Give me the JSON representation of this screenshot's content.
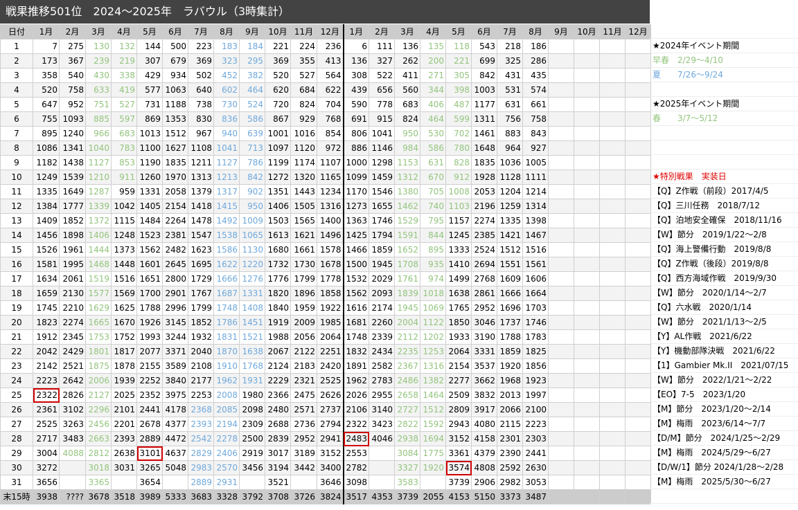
{
  "title": "戦果推移501位　2024～2025年　ラバウル（3時集計）",
  "header": [
    "日付",
    "1月",
    "2月",
    "3月",
    "4月",
    "5月",
    "6月",
    "7月",
    "8月",
    "9月",
    "10月",
    "11月",
    "12月",
    "1月",
    "2月",
    "3月",
    "4月",
    "5月",
    "6月",
    "7月",
    "8月",
    "9月",
    "10月",
    "11月",
    "12月"
  ],
  "footer_label": "末15時",
  "footer": [
    "3938",
    "????",
    "3678",
    "3518",
    "3989",
    "5333",
    "3683",
    "3328",
    "3792",
    "3708",
    "3726",
    "3824",
    "3517",
    "4353",
    "3739",
    "2055",
    "4153",
    "5150",
    "3373",
    "3487",
    "",
    "",
    "",
    "",
    ""
  ],
  "rows": [
    [
      7,
      275,
      130,
      132,
      144,
      500,
      223,
      183,
      184,
      221,
      224,
      236,
      6,
      111,
      136,
      135,
      118,
      543,
      218,
      186
    ],
    [
      173,
      367,
      239,
      219,
      307,
      679,
      369,
      323,
      295,
      369,
      355,
      413,
      136,
      327,
      262,
      200,
      221,
      699,
      325,
      286
    ],
    [
      358,
      540,
      430,
      338,
      429,
      934,
      502,
      452,
      382,
      520,
      527,
      564,
      308,
      522,
      411,
      271,
      305,
      842,
      431,
      435
    ],
    [
      520,
      758,
      633,
      419,
      577,
      1063,
      640,
      602,
      464,
      620,
      684,
      622,
      439,
      656,
      560,
      344,
      398,
      1003,
      531,
      574
    ],
    [
      647,
      952,
      751,
      527,
      731,
      1188,
      738,
      730,
      524,
      720,
      824,
      704,
      590,
      778,
      683,
      406,
      487,
      1177,
      631,
      661
    ],
    [
      755,
      1093,
      885,
      597,
      869,
      1353,
      830,
      836,
      586,
      867,
      929,
      768,
      691,
      915,
      824,
      464,
      599,
      1311,
      756,
      758
    ],
    [
      895,
      1240,
      966,
      683,
      1013,
      1512,
      967,
      940,
      639,
      1001,
      1016,
      854,
      806,
      1041,
      950,
      530,
      702,
      1461,
      883,
      843
    ],
    [
      1086,
      1341,
      1040,
      783,
      1100,
      1627,
      1108,
      1041,
      713,
      1097,
      1120,
      972,
      886,
      1146,
      984,
      586,
      780,
      1648,
      964,
      927
    ],
    [
      1182,
      1438,
      1127,
      853,
      1190,
      1835,
      1211,
      1127,
      786,
      1199,
      1174,
      1107,
      1000,
      1298,
      1153,
      631,
      828,
      1835,
      1036,
      1005
    ],
    [
      1249,
      1539,
      1210,
      911,
      1260,
      1970,
      1313,
      1213,
      842,
      1272,
      1320,
      1165,
      1099,
      1459,
      1312,
      670,
      912,
      1928,
      1128,
      1111
    ],
    [
      1335,
      1649,
      1287,
      959,
      1331,
      2058,
      1379,
      1317,
      902,
      1351,
      1443,
      1234,
      1170,
      1546,
      1380,
      705,
      1008,
      2053,
      1204,
      1214
    ],
    [
      1384,
      1777,
      1339,
      1042,
      1405,
      2154,
      1418,
      1415,
      950,
      1406,
      1505,
      1316,
      1273,
      1655,
      1462,
      740,
      1103,
      2196,
      1259,
      1314
    ],
    [
      1409,
      1852,
      1372,
      1115,
      1484,
      2264,
      1478,
      1492,
      1009,
      1503,
      1565,
      1400,
      1363,
      1746,
      1529,
      795,
      1157,
      2274,
      1335,
      1398
    ],
    [
      1456,
      1898,
      1406,
      1248,
      1523,
      2381,
      1547,
      1538,
      1065,
      1613,
      1621,
      1496,
      1425,
      1794,
      1591,
      844,
      1245,
      2385,
      1421,
      1467
    ],
    [
      1526,
      1961,
      1444,
      1373,
      1562,
      2482,
      1623,
      1586,
      1130,
      1680,
      1661,
      1578,
      1466,
      1859,
      1652,
      895,
      1333,
      2524,
      1512,
      1516
    ],
    [
      1581,
      1995,
      1468,
      1448,
      1601,
      2645,
      1695,
      1622,
      1220,
      1732,
      1730,
      1678,
      1500,
      1945,
      1708,
      935,
      1410,
      2694,
      1551,
      1561
    ],
    [
      1634,
      2061,
      1519,
      1516,
      1651,
      2800,
      1729,
      1666,
      1276,
      1776,
      1799,
      1778,
      1532,
      2029,
      1761,
      974,
      1499,
      2768,
      1609,
      1606
    ],
    [
      1659,
      2130,
      1577,
      1569,
      1700,
      2901,
      1767,
      1687,
      1331,
      1820,
      1896,
      1858,
      1562,
      2093,
      1839,
      1018,
      1638,
      2861,
      1666,
      1664
    ],
    [
      1745,
      2210,
      1629,
      1625,
      1788,
      2996,
      1799,
      1748,
      1408,
      1840,
      1959,
      1922,
      1616,
      2174,
      1945,
      1069,
      1765,
      2952,
      1696,
      1703
    ],
    [
      1823,
      2274,
      1665,
      1670,
      1926,
      3145,
      1852,
      1786,
      1451,
      1919,
      2009,
      1985,
      1681,
      2260,
      2004,
      1122,
      1850,
      3046,
      1737,
      1746
    ],
    [
      1912,
      2345,
      1753,
      1752,
      1993,
      3244,
      1932,
      1831,
      1521,
      1988,
      2056,
      2064,
      1748,
      2339,
      2112,
      1202,
      1933,
      3190,
      1788,
      1783
    ],
    [
      2042,
      2429,
      1801,
      1817,
      2077,
      3371,
      2040,
      1870,
      1638,
      2067,
      2122,
      2251,
      1832,
      2434,
      2235,
      1253,
      2064,
      3331,
      1859,
      1825
    ],
    [
      2142,
      2521,
      1875,
      1878,
      2155,
      3589,
      2108,
      1910,
      1768,
      2124,
      2183,
      2420,
      1891,
      2582,
      2367,
      1316,
      2154,
      3537,
      1920,
      1856
    ],
    [
      2223,
      2642,
      2006,
      1939,
      2252,
      3840,
      2177,
      1962,
      1931,
      2229,
      2321,
      2525,
      1962,
      2783,
      2486,
      1382,
      2277,
      3662,
      1968,
      1923
    ],
    [
      2322,
      2826,
      2127,
      2025,
      2352,
      3975,
      2253,
      2008,
      1980,
      2366,
      2475,
      2626,
      2026,
      2955,
      2658,
      1464,
      2509,
      3832,
      2013,
      1997
    ],
    [
      2361,
      3102,
      2296,
      2101,
      2441,
      4178,
      2368,
      2085,
      2098,
      2480,
      2571,
      2737,
      2106,
      3140,
      2727,
      1512,
      2809,
      3917,
      2066,
      2100
    ],
    [
      2525,
      3263,
      2456,
      2201,
      2678,
      4377,
      2393,
      2194,
      2309,
      2688,
      2736,
      2794,
      2322,
      3423,
      2822,
      1592,
      2943,
      4080,
      2115,
      2223
    ],
    [
      2717,
      3483,
      2663,
      2393,
      2889,
      4472,
      2542,
      2278,
      2500,
      2839,
      2952,
      2941,
      2483,
      4046,
      2938,
      1694,
      3152,
      4158,
      2301,
      2303
    ],
    [
      3004,
      4088,
      2812,
      2638,
      3101,
      4637,
      2829,
      2406,
      2919,
      3017,
      3189,
      3152,
      2553,
      "",
      3084,
      1775,
      3361,
      4379,
      2390,
      2441
    ],
    [
      3272,
      "",
      3018,
      3031,
      3265,
      5048,
      2983,
      2570,
      3456,
      3194,
      3442,
      3400,
      2782,
      "",
      3327,
      1920,
      3574,
      4808,
      2592,
      2630
    ],
    [
      3656,
      "",
      3365,
      "",
      3654,
      "",
      2889,
      2931,
      "",
      3521,
      "",
      3646,
      3098,
      "",
      3583,
      "",
      3739,
      2906,
      2982,
      3053
    ]
  ],
  "colors": {
    "default": "#000000",
    "event_green": "#93c47d",
    "event_blue": "#6fa8dc",
    "special_red": "#e00000"
  },
  "highlights": [
    [
      25,
      1
    ],
    [
      29,
      5
    ],
    [
      28,
      13
    ],
    [
      30,
      17
    ]
  ],
  "notes": [
    {
      "row": 1,
      "text": "★2024年イベント期間",
      "color": "k"
    },
    {
      "row": 2,
      "text": "早春　2/29～4/10",
      "color": "g"
    },
    {
      "row": 3,
      "text": "夏　　7/26～9/24",
      "color": "b"
    },
    {
      "row": 5,
      "text": "★2025年イベント期間",
      "color": "k"
    },
    {
      "row": 6,
      "text": "春　　3/7～5/12",
      "color": "g"
    },
    {
      "row": 10,
      "text": "★特別戦果　実装日",
      "color": "r"
    },
    {
      "row": 11,
      "text": "【Q】Z作戦（前段）2017/4/5",
      "color": "k"
    },
    {
      "row": 12,
      "text": "【Q】三川任務　2018/7/12",
      "color": "k"
    },
    {
      "row": 13,
      "text": "【Q】泊地安全確保　2018/11/16",
      "color": "k"
    },
    {
      "row": 14,
      "text": "【W】節分　2019/1/22～2/8",
      "color": "k"
    },
    {
      "row": 15,
      "text": "【Q】海上警備行動　2019/8/8",
      "color": "k"
    },
    {
      "row": 16,
      "text": "【Q】Z作戦（後段）2019/8/8",
      "color": "k"
    },
    {
      "row": 17,
      "text": "【Q】西方海域作戦　2019/9/30",
      "color": "k"
    },
    {
      "row": 18,
      "text": "【W】節分　2020/1/14～2/7",
      "color": "k"
    },
    {
      "row": 19,
      "text": "【Q】六水戦　2020/1/14",
      "color": "k"
    },
    {
      "row": 20,
      "text": "【W】節分　2021/1/13～2/5",
      "color": "k"
    },
    {
      "row": 21,
      "text": "【Y】AL作戦　2021/6/22",
      "color": "k"
    },
    {
      "row": 22,
      "text": "【Y】機動部隊決戦　2021/6/22",
      "color": "k"
    },
    {
      "row": 23,
      "text": "【1】Gambier Mk.II　2021/07/15",
      "color": "k"
    },
    {
      "row": 24,
      "text": "【W】節分　2022/1/21～2/22",
      "color": "k"
    },
    {
      "row": 25,
      "text": "【EO】7-5　2023/1/20",
      "color": "k"
    },
    {
      "row": 26,
      "text": "【M】節分　2023/1/20～2/14",
      "color": "k"
    },
    {
      "row": 27,
      "text": "【M】梅雨　2023/6/14～7/7",
      "color": "k"
    },
    {
      "row": 28,
      "text": "【D/M】節分　2024/1/25～2/29",
      "color": "k"
    },
    {
      "row": 29,
      "text": "【M】梅雨　2024/5/29～6/27",
      "color": "k"
    },
    {
      "row": 30,
      "text": "【D/W/1】節分 2024/1/28～2/28",
      "color": "k"
    },
    {
      "row": 31,
      "text": "【M】梅雨　2025/5/30～6/27",
      "color": "k"
    }
  ]
}
